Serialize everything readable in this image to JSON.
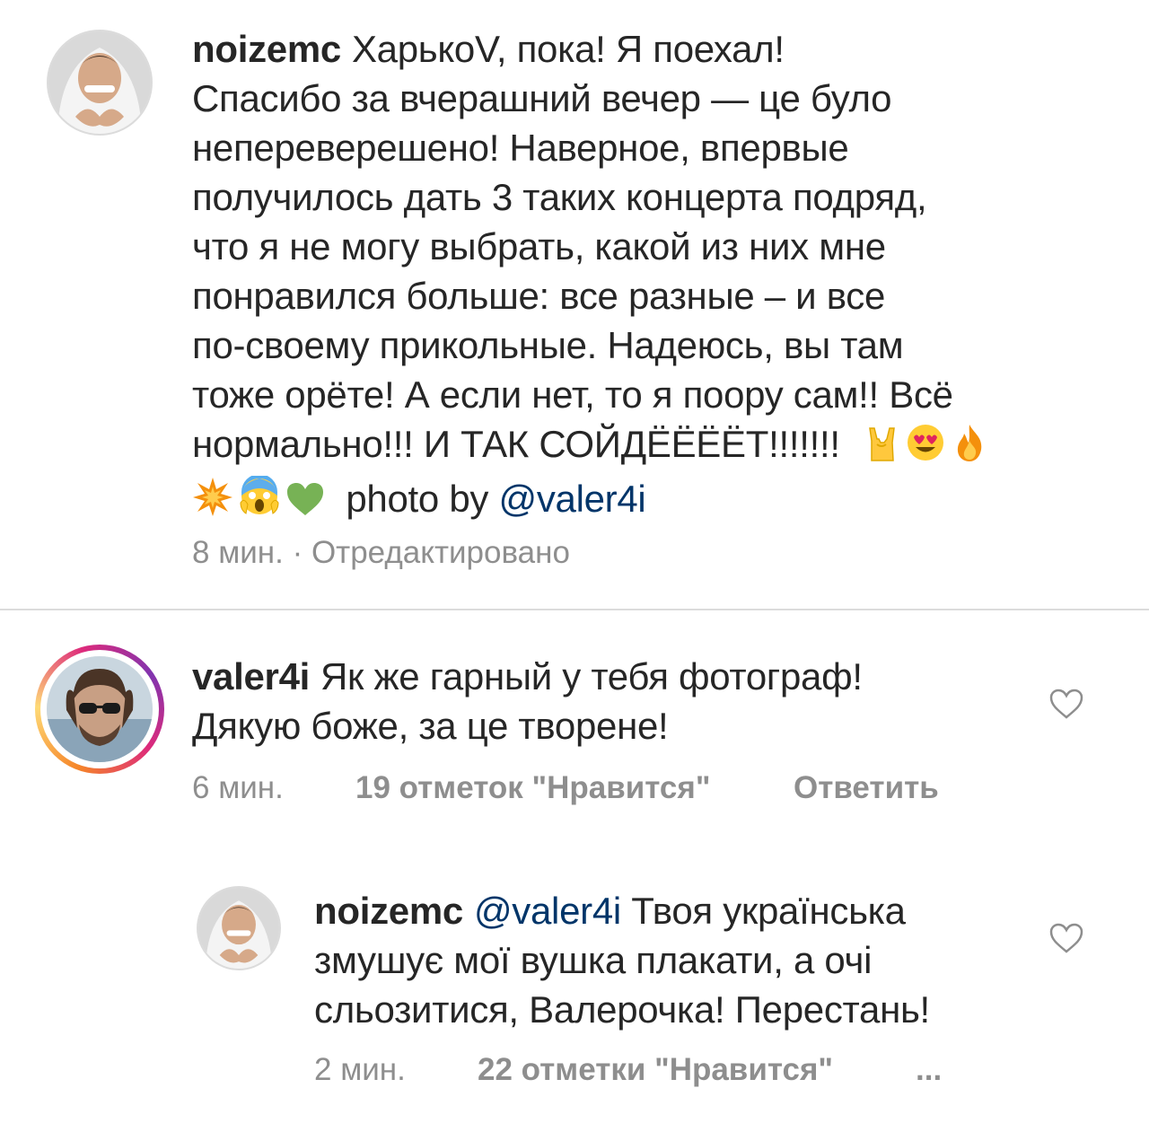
{
  "post": {
    "username": "noizemc",
    "caption_lines": [
      "ХарькоV, пока! Я поехал!",
      "Спасибо за вчерашний вечер — це було",
      "непереверешено! Наверное, впервые",
      "получилось дать 3 таких концерта подряд,",
      "что я не могу выбрать, какой из них мне",
      "понравился больше: все разные – и все",
      "по-своему прикольные. Надеюсь, вы там",
      "тоже орёте! А если нет, то я поору сам!! Всё",
      "нормально!!! И ТАК СОЙДЁЁЁЁТ!!!!!!!"
    ],
    "emoji_row_1": [
      "sign-of-horns",
      "heart-eyes",
      "fire"
    ],
    "emoji_row_2": [
      "collision",
      "screaming-face",
      "green-heart"
    ],
    "photo_by_label": "photo by",
    "photo_by_mention": "@valer4i",
    "time": "8 мин.",
    "edited": " · Отредактировано"
  },
  "comment1": {
    "username": "valer4i",
    "lines": [
      "Як же гарный у тебя фотограф!",
      "Дякую боже, за це творене!"
    ],
    "time": "6 мин.",
    "likes": "19 отметок \"Нравится\"",
    "reply": "Ответить"
  },
  "reply1": {
    "username": "noizemc",
    "mention": "@valer4i",
    "lines": [
      "Твоя українська",
      "змушує мої вушка плакати, а очі",
      "сльозитися, Валерочка! Перестань!"
    ],
    "time": "2 мин.",
    "likes": "22 отметки \"Нравится\"",
    "more": "..."
  },
  "colors": {
    "text": "#262626",
    "meta": "#8e8e8e",
    "mention": "#003569",
    "divider": "#dbdbdb"
  }
}
